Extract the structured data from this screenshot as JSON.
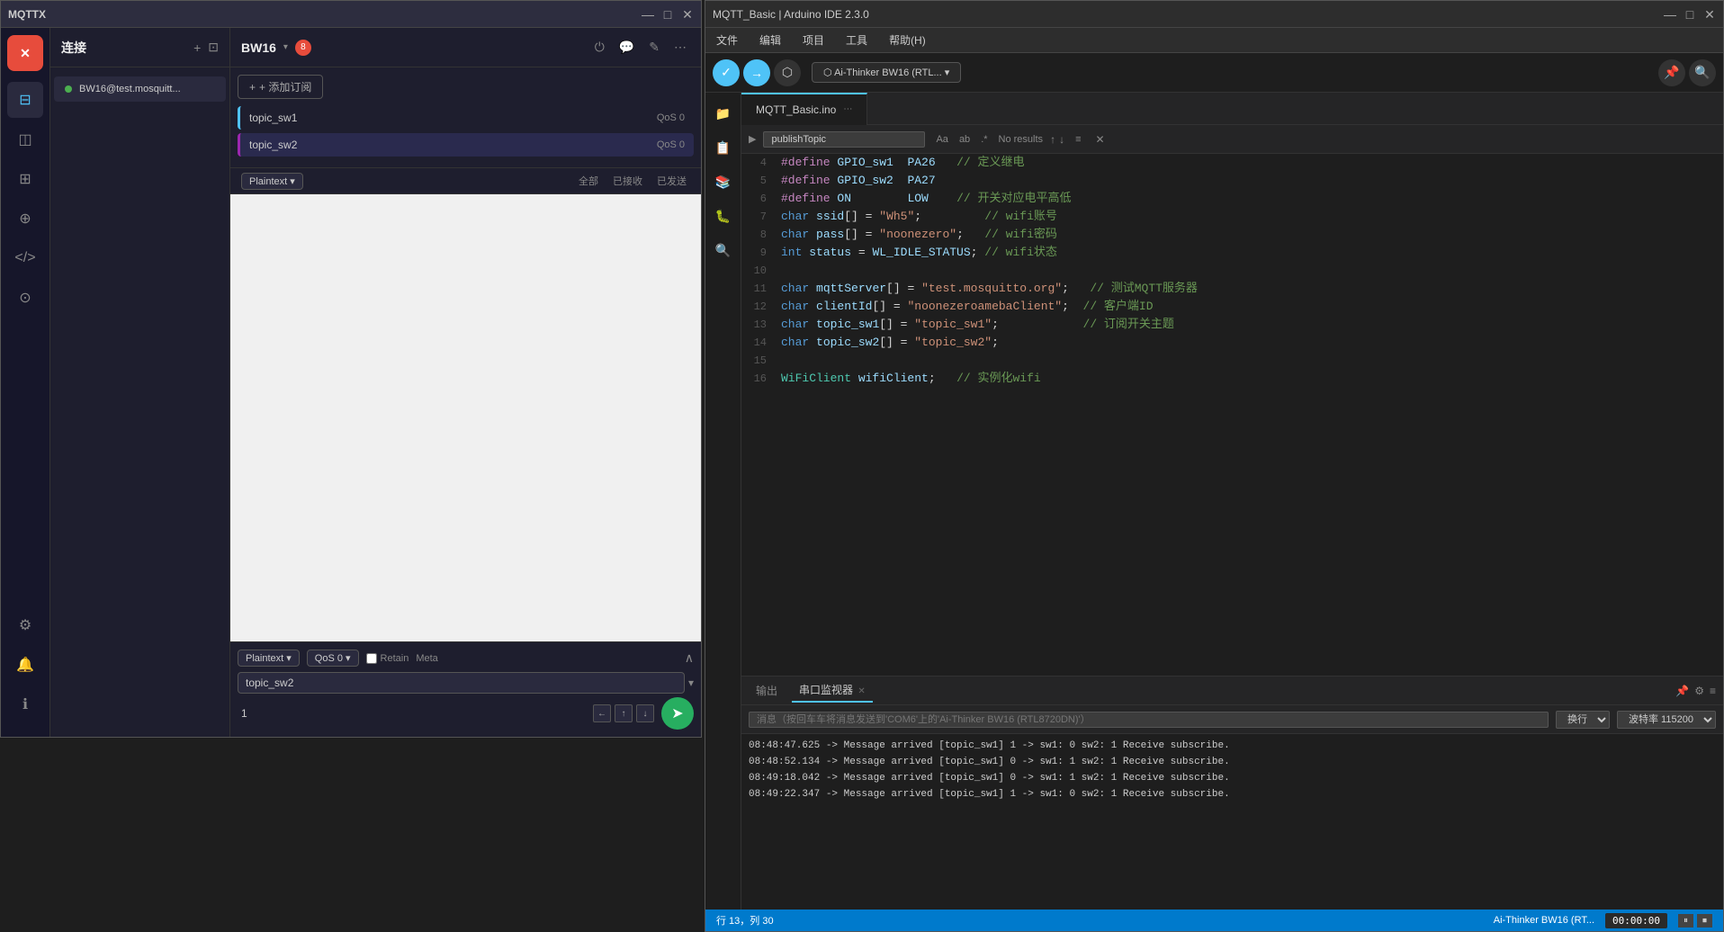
{
  "mqttx": {
    "title": "MQTTX",
    "window_controls": [
      "—",
      "□",
      "✕"
    ],
    "sidebar": {
      "logo": "✕",
      "icons": [
        {
          "name": "connection-icon",
          "symbol": "⊟",
          "active": true
        },
        {
          "name": "script-icon",
          "symbol": "◫"
        },
        {
          "name": "log-icon",
          "symbol": "⊞"
        },
        {
          "name": "plugin-icon",
          "symbol": "⊕"
        },
        {
          "name": "code-icon",
          "symbol": "◁"
        },
        {
          "name": "database-icon",
          "symbol": "⊙"
        }
      ],
      "bottom_icons": [
        {
          "name": "settings-icon",
          "symbol": "⚙"
        },
        {
          "name": "notification-icon",
          "symbol": "🔔"
        },
        {
          "name": "info-icon",
          "symbol": "ℹ"
        }
      ]
    },
    "connection_panel": {
      "title": "连接",
      "add_btn": "+",
      "layout_btn": "⊡",
      "connection": {
        "name": "BW16@test.mosquitt...",
        "connected": true
      }
    },
    "main": {
      "connection_name": "BW16",
      "status_count": "8",
      "toolbar_icons": [
        "⏻",
        "💬",
        "✎",
        "⋯"
      ],
      "subscribe_btn": "+ 添加订阅",
      "subscriptions": [
        {
          "name": "topic_sw1",
          "qos": "QoS 0",
          "active": false
        },
        {
          "name": "topic_sw2",
          "qos": "QoS 0",
          "active": true
        }
      ],
      "message_format": "Plaintext",
      "filter_tabs": [
        {
          "label": "全部",
          "active": false
        },
        {
          "label": "已接收",
          "active": false
        },
        {
          "label": "已发送",
          "active": false
        }
      ],
      "publish": {
        "format": "Plaintext",
        "qos": "QoS 0",
        "retain_label": "Retain",
        "meta_label": "Meta",
        "topic": "topic_sw2",
        "message": "1"
      }
    }
  },
  "arduino": {
    "title": "MQTT_Basic | Arduino IDE 2.3.0",
    "window_controls": [
      "—",
      "□",
      "✕"
    ],
    "menubar": [
      "文件",
      "编辑",
      "项目",
      "工具",
      "帮助(H)"
    ],
    "toolbar": {
      "board_name": "Ai-Thinker BW16 (RTL..."
    },
    "file_tab": "MQTT_Basic.ino",
    "search": {
      "label": "▶ publishTopic",
      "format_btn": "Aa",
      "case_btn": "ab",
      "regex_btn": ".*",
      "result_text": "No results"
    },
    "code": [
      {
        "line": 4,
        "content": "#define GPIO_sw1  PA26   // 定义继电"
      },
      {
        "line": 5,
        "content": "#define GPIO_sw2  PA27"
      },
      {
        "line": 6,
        "content": "#define ON        LOW    // 开关对应电平高低"
      },
      {
        "line": 7,
        "content": "char ssid[] = \"Wh5\";         // wifi账号"
      },
      {
        "line": 8,
        "content": "char pass[] = \"noonezero\";   // wifi密码"
      },
      {
        "line": 9,
        "content": "int status = WL_IDLE_STATUS; // wifi状态"
      },
      {
        "line": 10,
        "content": ""
      },
      {
        "line": 11,
        "content": "char mqttServer[] = \"test.mosquitto.org\";   // 测试MQTT服务器"
      },
      {
        "line": 12,
        "content": "char clientId[] = \"noonezeroamebaClient\";  // 客户端ID"
      },
      {
        "line": 13,
        "content": "char topic_sw1[] = \"topic_sw1\";            // 订阅开关主题"
      },
      {
        "line": 14,
        "content": "char topic_sw2[] = \"topic_sw2\";"
      },
      {
        "line": 15,
        "content": ""
      },
      {
        "line": 16,
        "content": "WiFiClient wifiClient;   // 实例化wifi"
      }
    ],
    "bottom_panel": {
      "tabs": [
        {
          "label": "输出",
          "active": false
        },
        {
          "label": "串口监视器",
          "active": true
        },
        {
          "close": true
        }
      ],
      "serial_input_placeholder": "消息（按回车车将消息发送到'COM6'上的'Ai-Thinker BW16 (RTL8720DN)'）",
      "send_options": [
        "换行"
      ],
      "baud_rates": [
        "波特率 115200"
      ],
      "serial_lines": [
        "08:48:47.625 -> Message arrived [topic_sw1] 1 -> sw1: 0 sw2: 1    Receive subscribe.",
        "08:48:52.134 -> Message arrived [topic_sw1] 0 -> sw1: 1 sw2: 1    Receive subscribe.",
        "08:49:18.042 -> Message arrived [topic_sw1] 0 -> sw1: 1 sw2: 1    Receive subscribe.",
        "08:49:22.347 -> Message arrived [topic_sw1] 1 -> sw1: 0 sw2: 1    Receive subscribe."
      ]
    },
    "status_bar": {
      "position": "行 13，列 30",
      "board": "Ai-Thinker BW16 (RT...",
      "timer": "00:00:00"
    }
  }
}
